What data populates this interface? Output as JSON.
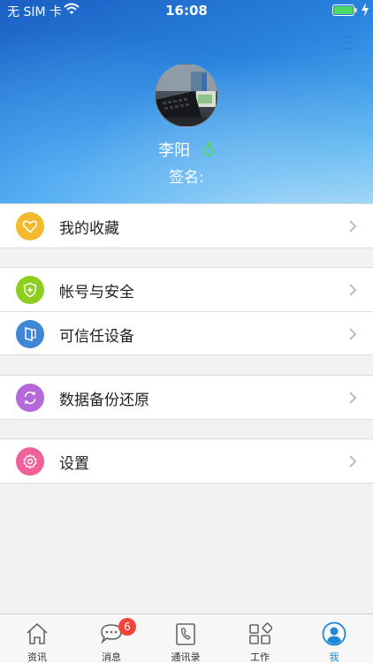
{
  "status_bar": {
    "carrier": "无 SIM 卡",
    "time": "16:08"
  },
  "profile": {
    "name": "李阳",
    "signature_label": "签名:"
  },
  "menu_groups": [
    [
      {
        "label": "我的收藏",
        "icon": "heart-icon",
        "color": "#f5b92e"
      }
    ],
    [
      {
        "label": "帐号与安全",
        "icon": "shield-icon",
        "color": "#8ccf1f"
      },
      {
        "label": "可信任设备",
        "icon": "device-icon",
        "color": "#3f86d6"
      }
    ],
    [
      {
        "label": "数据备份还原",
        "icon": "sync-icon",
        "color": "#b66ad9"
      }
    ],
    [
      {
        "label": "设置",
        "icon": "gear-icon",
        "color": "#f0609a"
      }
    ]
  ],
  "tabs": [
    {
      "label": "资讯",
      "icon": "home-icon"
    },
    {
      "label": "消息",
      "icon": "chat-icon",
      "badge": "6"
    },
    {
      "label": "通讯录",
      "icon": "contacts-icon"
    },
    {
      "label": "工作",
      "icon": "apps-icon"
    },
    {
      "label": "我",
      "icon": "profile-icon",
      "active": true
    }
  ],
  "colors": {
    "accent": "#1e88d8",
    "badge": "#f0443a"
  }
}
